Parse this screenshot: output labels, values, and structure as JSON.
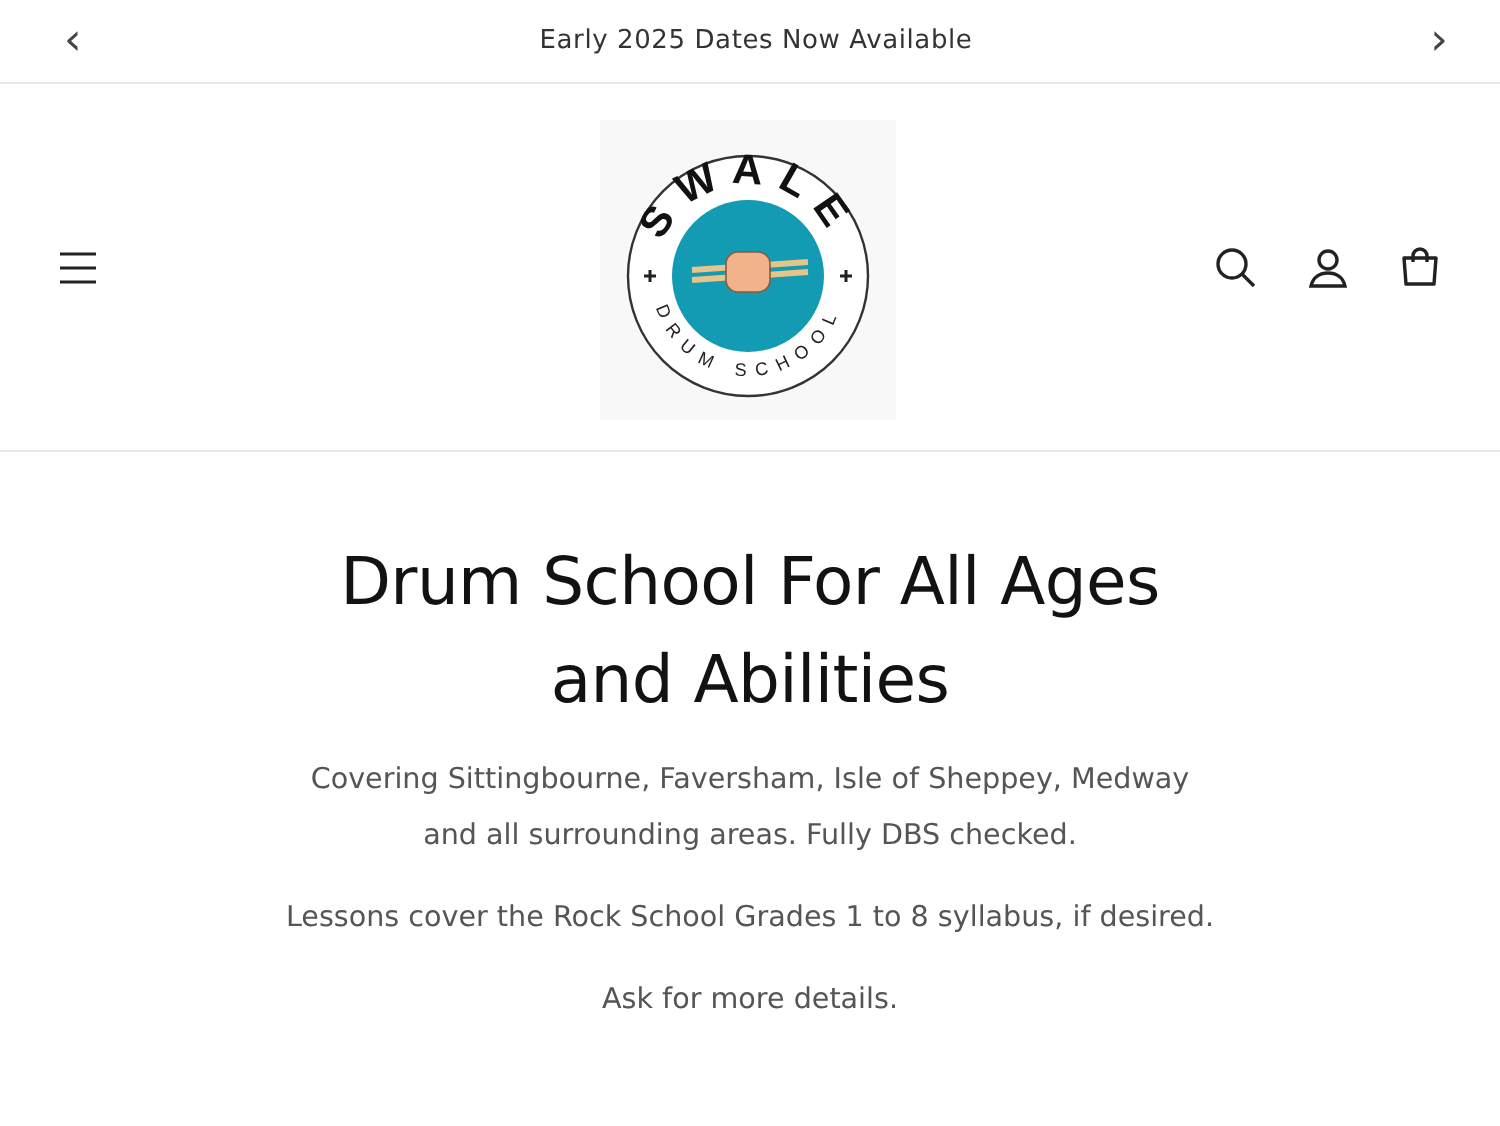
{
  "announcement": {
    "prev": "‹",
    "text": "Early 2025 Dates Now Available",
    "next": "›"
  },
  "header": {
    "logo": {
      "title": "SWALE",
      "subtitle": "DRUM SCHOOL"
    }
  },
  "hero": {
    "heading": "Drum School For All Ages and Abilities",
    "paragraphs": [
      "Covering Sittingbourne, Faversham, Isle of Sheppey, Medway and all surrounding areas. Fully DBS checked.",
      "Lessons cover the Rock School Grades 1 to 8 syllabus, if desired.",
      "Ask for more details."
    ]
  }
}
